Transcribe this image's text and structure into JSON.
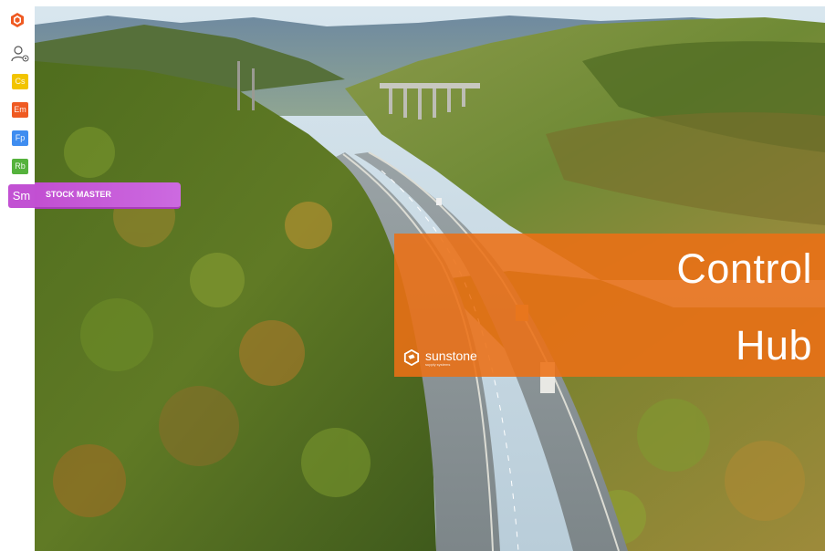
{
  "sidebar": {
    "apps": [
      {
        "abbr": "Cs",
        "color": "#f2c400"
      },
      {
        "abbr": "Em",
        "color": "#ef5a22"
      },
      {
        "abbr": "Fp",
        "color": "#3f8df0"
      },
      {
        "abbr": "Rb",
        "color": "#55b23c"
      },
      {
        "abbr": "Sm",
        "color": "#c251d3"
      }
    ],
    "active_tooltip": "STOCK MASTER",
    "icons": {
      "logo": "hexagon-logo-icon",
      "user": "user-settings-icon"
    }
  },
  "hero": {
    "banner": {
      "title_line1": "Control",
      "title_line2": "Hub",
      "brand_name": "sunstone",
      "brand_tagline": "supply systems"
    },
    "banner_color": "#ec7014"
  }
}
